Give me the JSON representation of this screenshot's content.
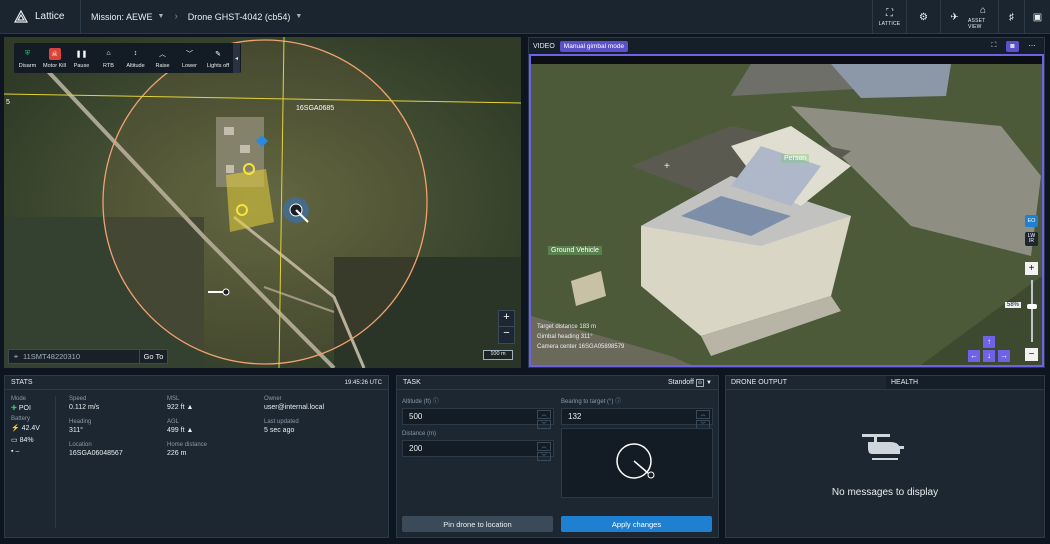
{
  "topbar": {
    "brand": "Lattice",
    "mission": "Mission: AEWE",
    "drone": "Drone GHST-4042 (cb54)",
    "lattice_btn": "LATTICE",
    "asset_view_btn": "ASSET VIEW"
  },
  "toolbar": [
    {
      "label": "Disarm",
      "icon": "shield-icon"
    },
    {
      "label": "Motor Kill",
      "icon": "skull-icon"
    },
    {
      "label": "Pause",
      "icon": "pause-icon"
    },
    {
      "label": "RTB",
      "icon": "home-icon"
    },
    {
      "label": "Altitude",
      "icon": "altitude-icon"
    },
    {
      "label": "Raise",
      "icon": "chevron-up-icon"
    },
    {
      "label": "Lower",
      "icon": "chevron-down-icon"
    },
    {
      "label": "Lights off",
      "icon": "lights-off-icon"
    }
  ],
  "map": {
    "grid_label": "16SGA0685",
    "grid_number": "5",
    "search_value": "11SMT48220310",
    "goto": "Go To",
    "scale": "100 m",
    "zoom_in": "+",
    "zoom_out": "−"
  },
  "video": {
    "title": "VIDEO",
    "mode": "Manual gimbal mode",
    "labels": {
      "person": "Person",
      "vehicle": "Ground Vehicle"
    },
    "overlay": [
      "Target distance 183 m",
      "Gimbal heading 311°",
      "Camera center 16SGA05898579"
    ],
    "eo": "EO",
    "lwir": "LW IR",
    "zoom_pct": "58%",
    "zoom_in": "+",
    "zoom_out": "−"
  },
  "stats": {
    "title": "STATS",
    "time": "19:45:26 UTC",
    "mode_label": "Mode",
    "mode_value": "POI",
    "battery_label": "Battery",
    "battery_voltage": "42.4V",
    "battery_pct": "84%",
    "signal": "–",
    "speed_label": "Speed",
    "speed": "0.112 m/s",
    "heading_label": "Heading",
    "heading": "311°",
    "location_label": "Location",
    "location": "16SGA06048567",
    "msl_label": "MSL",
    "msl": "922 ft",
    "agl_label": "AGL",
    "agl": "499 ft",
    "home_label": "Home distance",
    "home": "226 m",
    "owner_label": "Owner",
    "owner": "user@internal.local",
    "updated_label": "Last updated",
    "updated": "5 sec ago"
  },
  "task": {
    "title": "TASK",
    "mode": "Standoff",
    "altitude_label": "Altitude (ft)",
    "altitude": "500",
    "distance_label": "Distance (m)",
    "distance": "200",
    "bearing_label": "Bearing to target (°)",
    "bearing": "132",
    "pin_button": "Pin drone to location",
    "apply_button": "Apply changes"
  },
  "output": {
    "tab1": "DRONE OUTPUT",
    "tab2": "HEALTH",
    "empty": "No messages to display"
  },
  "colors": {
    "accent": "#1f7fd1",
    "purple": "#6e62e6",
    "danger": "#d9433a",
    "success": "#2fbf71"
  }
}
